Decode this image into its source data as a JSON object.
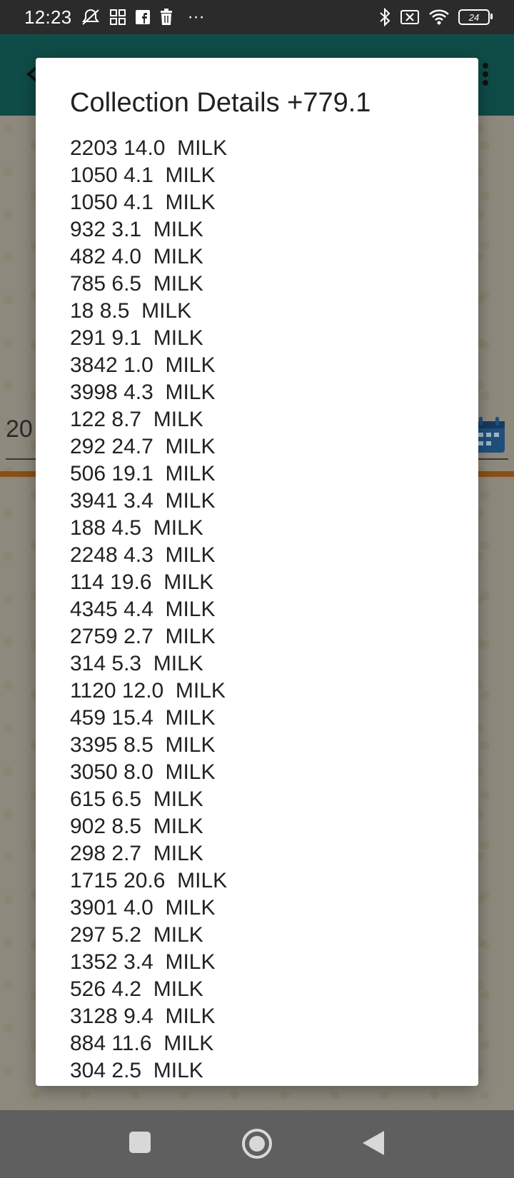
{
  "status_bar": {
    "time": "12:23",
    "dots": "···",
    "battery": "24"
  },
  "date_field": {
    "value": "20"
  },
  "dialog": {
    "title": "Collection Details +779.1",
    "rows": [
      "2203 14.0  MILK",
      "1050 4.1  MILK",
      "1050 4.1  MILK",
      "932 3.1  MILK",
      "482 4.0  MILK",
      "785 6.5  MILK",
      "18 8.5  MILK",
      "291 9.1  MILK",
      "3842 1.0  MILK",
      "3998 4.3  MILK",
      "122 8.7  MILK",
      "292 24.7  MILK",
      "506 19.1  MILK",
      "3941 3.4  MILK",
      "188 4.5  MILK",
      "2248 4.3  MILK",
      "114 19.6  MILK",
      "4345 4.4  MILK",
      "2759 2.7  MILK",
      "314 5.3  MILK",
      "1120 12.0  MILK",
      "459 15.4  MILK",
      "3395 8.5  MILK",
      "3050 8.0  MILK",
      "615 6.5  MILK",
      "902 8.5  MILK",
      "298 2.7  MILK",
      "1715 20.6  MILK",
      "3901 4.0  MILK",
      "297 5.2  MILK",
      "1352 3.4  MILK",
      "526 4.2  MILK",
      "3128 9.4  MILK",
      "884 11.6  MILK",
      "304 2.5  MILK"
    ]
  },
  "icons": {
    "status": [
      "mute-icon",
      "app-grid-icon",
      "facebook-icon",
      "trash-icon",
      "bluetooth-icon",
      "sim-off-icon",
      "wifi-icon",
      "battery-icon"
    ],
    "app": [
      "back-arrow-icon",
      "overflow-menu-icon",
      "calendar-icon"
    ],
    "nav": [
      "recents-icon",
      "home-icon",
      "back-icon"
    ]
  },
  "colors": {
    "app_bar": "#0f4c47",
    "accent_divider": "#8a4f15",
    "dialog_bg": "#ffffff"
  }
}
